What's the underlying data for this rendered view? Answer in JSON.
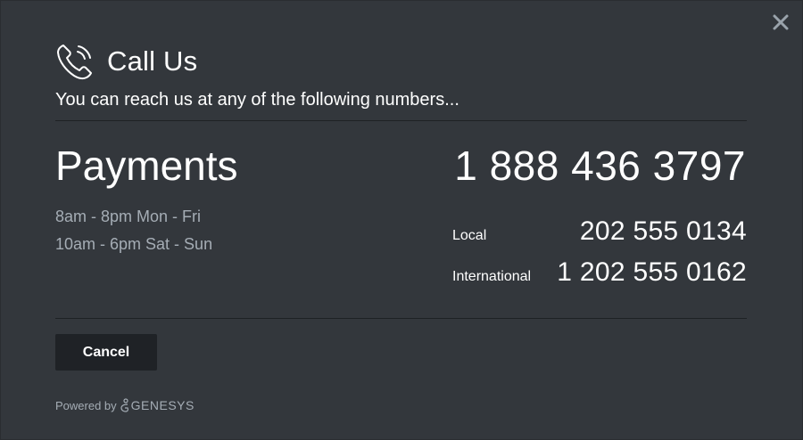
{
  "dialog": {
    "title": "Call Us",
    "subtitle": "You can reach us at any of the following numbers...",
    "close_icon": "close-icon",
    "phone_icon": "phone-icon"
  },
  "department": {
    "name": "Payments",
    "main_number": "1 888 436 3797",
    "hours": [
      "8am - 8pm Mon - Fri",
      "10am - 6pm Sat - Sun"
    ],
    "numbers": [
      {
        "label": "Local",
        "value": "202 555 0134"
      },
      {
        "label": "International",
        "value": "1 202 555 0162"
      }
    ]
  },
  "footer": {
    "cancel_label": "Cancel",
    "powered_by": "Powered by",
    "brand": "GENESYS"
  },
  "colors": {
    "background": "#33373c",
    "muted_text": "#a5adb5",
    "button_bg": "#1f2226"
  }
}
